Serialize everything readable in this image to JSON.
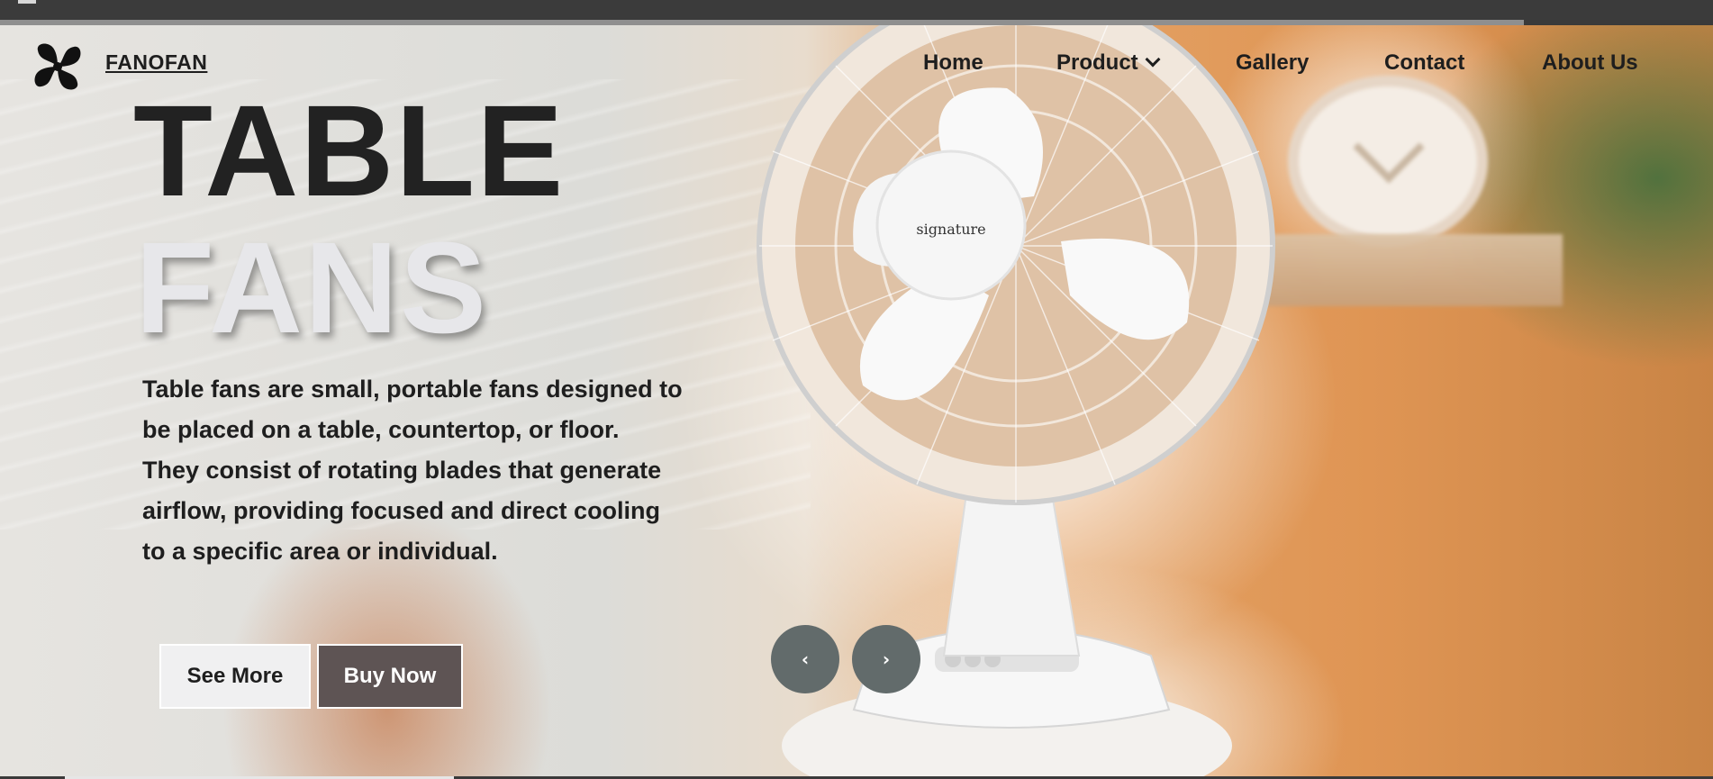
{
  "site": {
    "brand": "FANOFAN"
  },
  "nav": {
    "items": [
      {
        "label": "Home"
      },
      {
        "label": "Product"
      },
      {
        "label": "Gallery"
      },
      {
        "label": "Contact"
      },
      {
        "label": "About Us"
      }
    ]
  },
  "hero": {
    "title_line1": "TABLE",
    "title_line2": "FANS",
    "description": "Table fans are small, portable fans designed to be placed on a table, countertop, or floor. They consist of rotating blades that generate airflow, providing focused and direct cooling to a specific area or individual.",
    "fan_brand_text": "signature",
    "buttons": {
      "see_more": "See More",
      "buy_now": "Buy Now"
    },
    "carousel": {
      "prev_icon": "chevron-left-icon",
      "next_icon": "chevron-right-icon"
    }
  },
  "icons": {
    "logo": "fan-logo-icon",
    "product_dropdown": "chevron-down-icon"
  },
  "colors": {
    "text_dark": "#1e1e1e",
    "title_light": "#e7e7ea",
    "buy_button": "#5e5454",
    "carousel_button": "#626b6b",
    "background_orange": "#df9554"
  }
}
